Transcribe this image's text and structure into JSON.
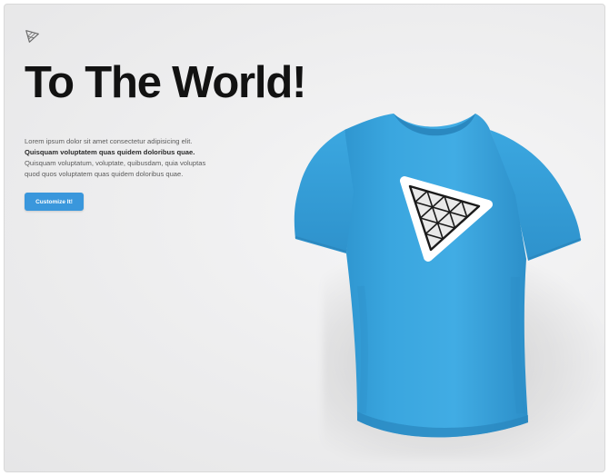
{
  "hero": {
    "title": "To The World!",
    "copy_line_1": "Lorem ipsum dolor sit amet consectetur adipisicing elit.",
    "copy_line_2": "Quisquam voluptatem quas quidem doloribus quae.",
    "copy_line_3": "Quisquam voluptatum, voluptate, quibusdam, quia voluptas",
    "copy_line_4": "quod quos voluptatem quas quidem doloribus quae.",
    "cta_label": "Customize It!"
  },
  "brand": {
    "logo_icon": "triangle-grid-logo-icon"
  },
  "product": {
    "image": "blue-tshirt-with-triangle-logo",
    "shirt_color": "#3aa3dd",
    "accent_color": "#3a97dc"
  }
}
